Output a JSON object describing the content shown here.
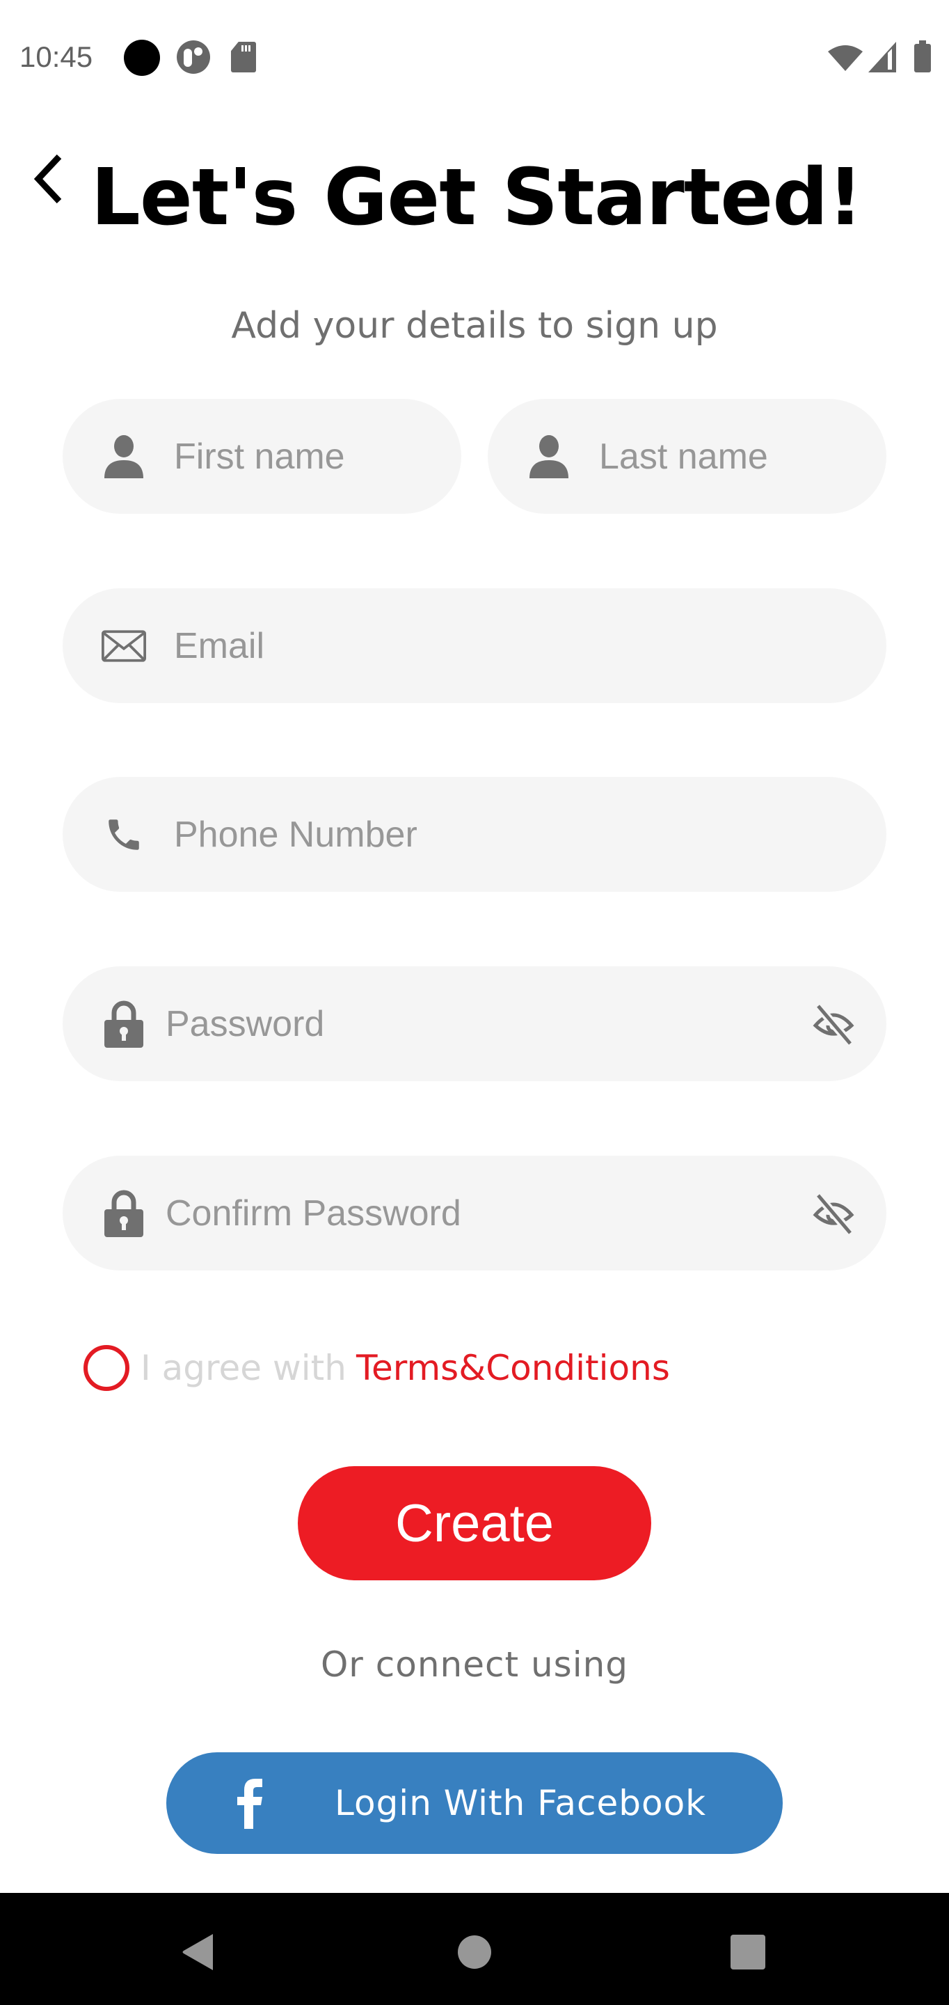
{
  "status_bar": {
    "time": "10:45",
    "left_icons": [
      "notification-dot-icon",
      "app-notification-icon",
      "sd-card-icon"
    ],
    "right_icons": [
      "wifi-icon",
      "cell-signal-icon",
      "battery-icon"
    ]
  },
  "header": {
    "back_icon": "chevron-left-icon",
    "title": "Let's Get Started!",
    "subtitle": "Add your details to sign up"
  },
  "form": {
    "first_name": {
      "placeholder": "First name",
      "value": "",
      "icon": "person-icon"
    },
    "last_name": {
      "placeholder": "Last name",
      "value": "",
      "icon": "person-icon"
    },
    "email": {
      "placeholder": "Email",
      "value": "",
      "icon": "envelope-icon"
    },
    "phone": {
      "placeholder": "Phone Number",
      "value": "",
      "icon": "phone-icon"
    },
    "password": {
      "placeholder": "Password",
      "value": "",
      "icon": "lock-icon",
      "toggle_icon": "eye-off-icon"
    },
    "confirm_password": {
      "placeholder": "Confirm Password",
      "value": "",
      "icon": "lock-icon",
      "toggle_icon": "eye-off-icon"
    }
  },
  "terms": {
    "checked": false,
    "prefix": "I agree with",
    "link": "Terms&Conditions"
  },
  "actions": {
    "create_label": "Create",
    "or_text": "Or connect using",
    "facebook_label": "Login With Facebook"
  },
  "colors": {
    "accent_red": "#ed1c24",
    "facebook_blue": "#3880c0",
    "field_bg": "#f5f5f5",
    "placeholder": "#979797"
  },
  "nav_bar": {
    "buttons": [
      "back-triangle-icon",
      "home-circle-icon",
      "recents-square-icon"
    ]
  }
}
